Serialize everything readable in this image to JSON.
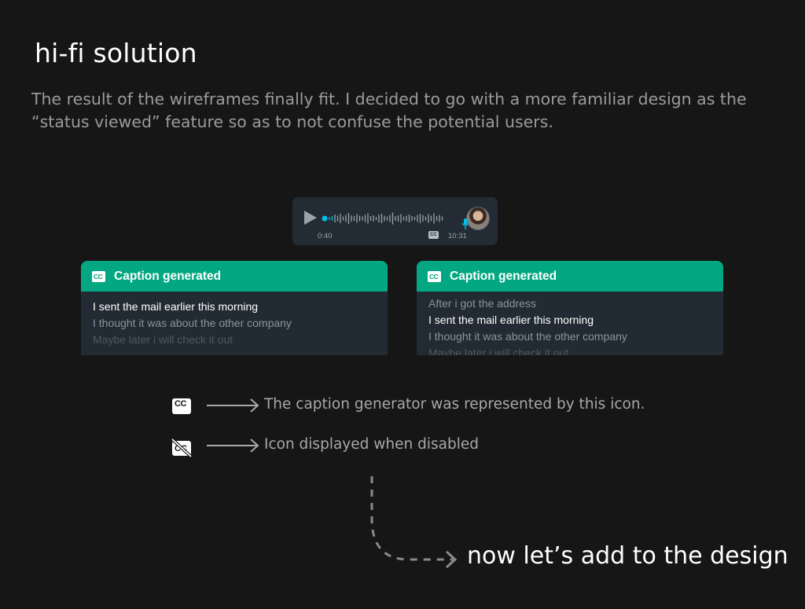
{
  "header": {
    "title": "hi-fi solution",
    "description": "The result of the wireframes finally fit. I decided to go with a more familiar design as the “status viewed” feature so as to not confuse the potential users."
  },
  "voice_message": {
    "elapsed": "0:40",
    "timestamp": "10:31",
    "cc_badge": "CC"
  },
  "caption_cards": [
    {
      "title": "Caption generated",
      "icon": "cc-icon",
      "lines": [
        "I sent the mail earlier this morning",
        "I thought it was about the other company",
        "Maybe later i will check it out"
      ]
    },
    {
      "title": "Caption generated",
      "icon": "cc-icon",
      "lines": [
        "After i got the address",
        "I sent the mail earlier this morning",
        "I thought it was about the other company",
        "Maybe later i will check it out"
      ]
    }
  ],
  "legend": {
    "enabled_text": "The caption generator was represented by this icon.",
    "disabled_text": "Icon displayed when disabled",
    "icon_label": "CC"
  },
  "cta": "now let’s add to the design",
  "colors": {
    "background": "#161616",
    "accent": "#03a882",
    "card": "#222b33",
    "wave_active": "#00c2e8"
  }
}
